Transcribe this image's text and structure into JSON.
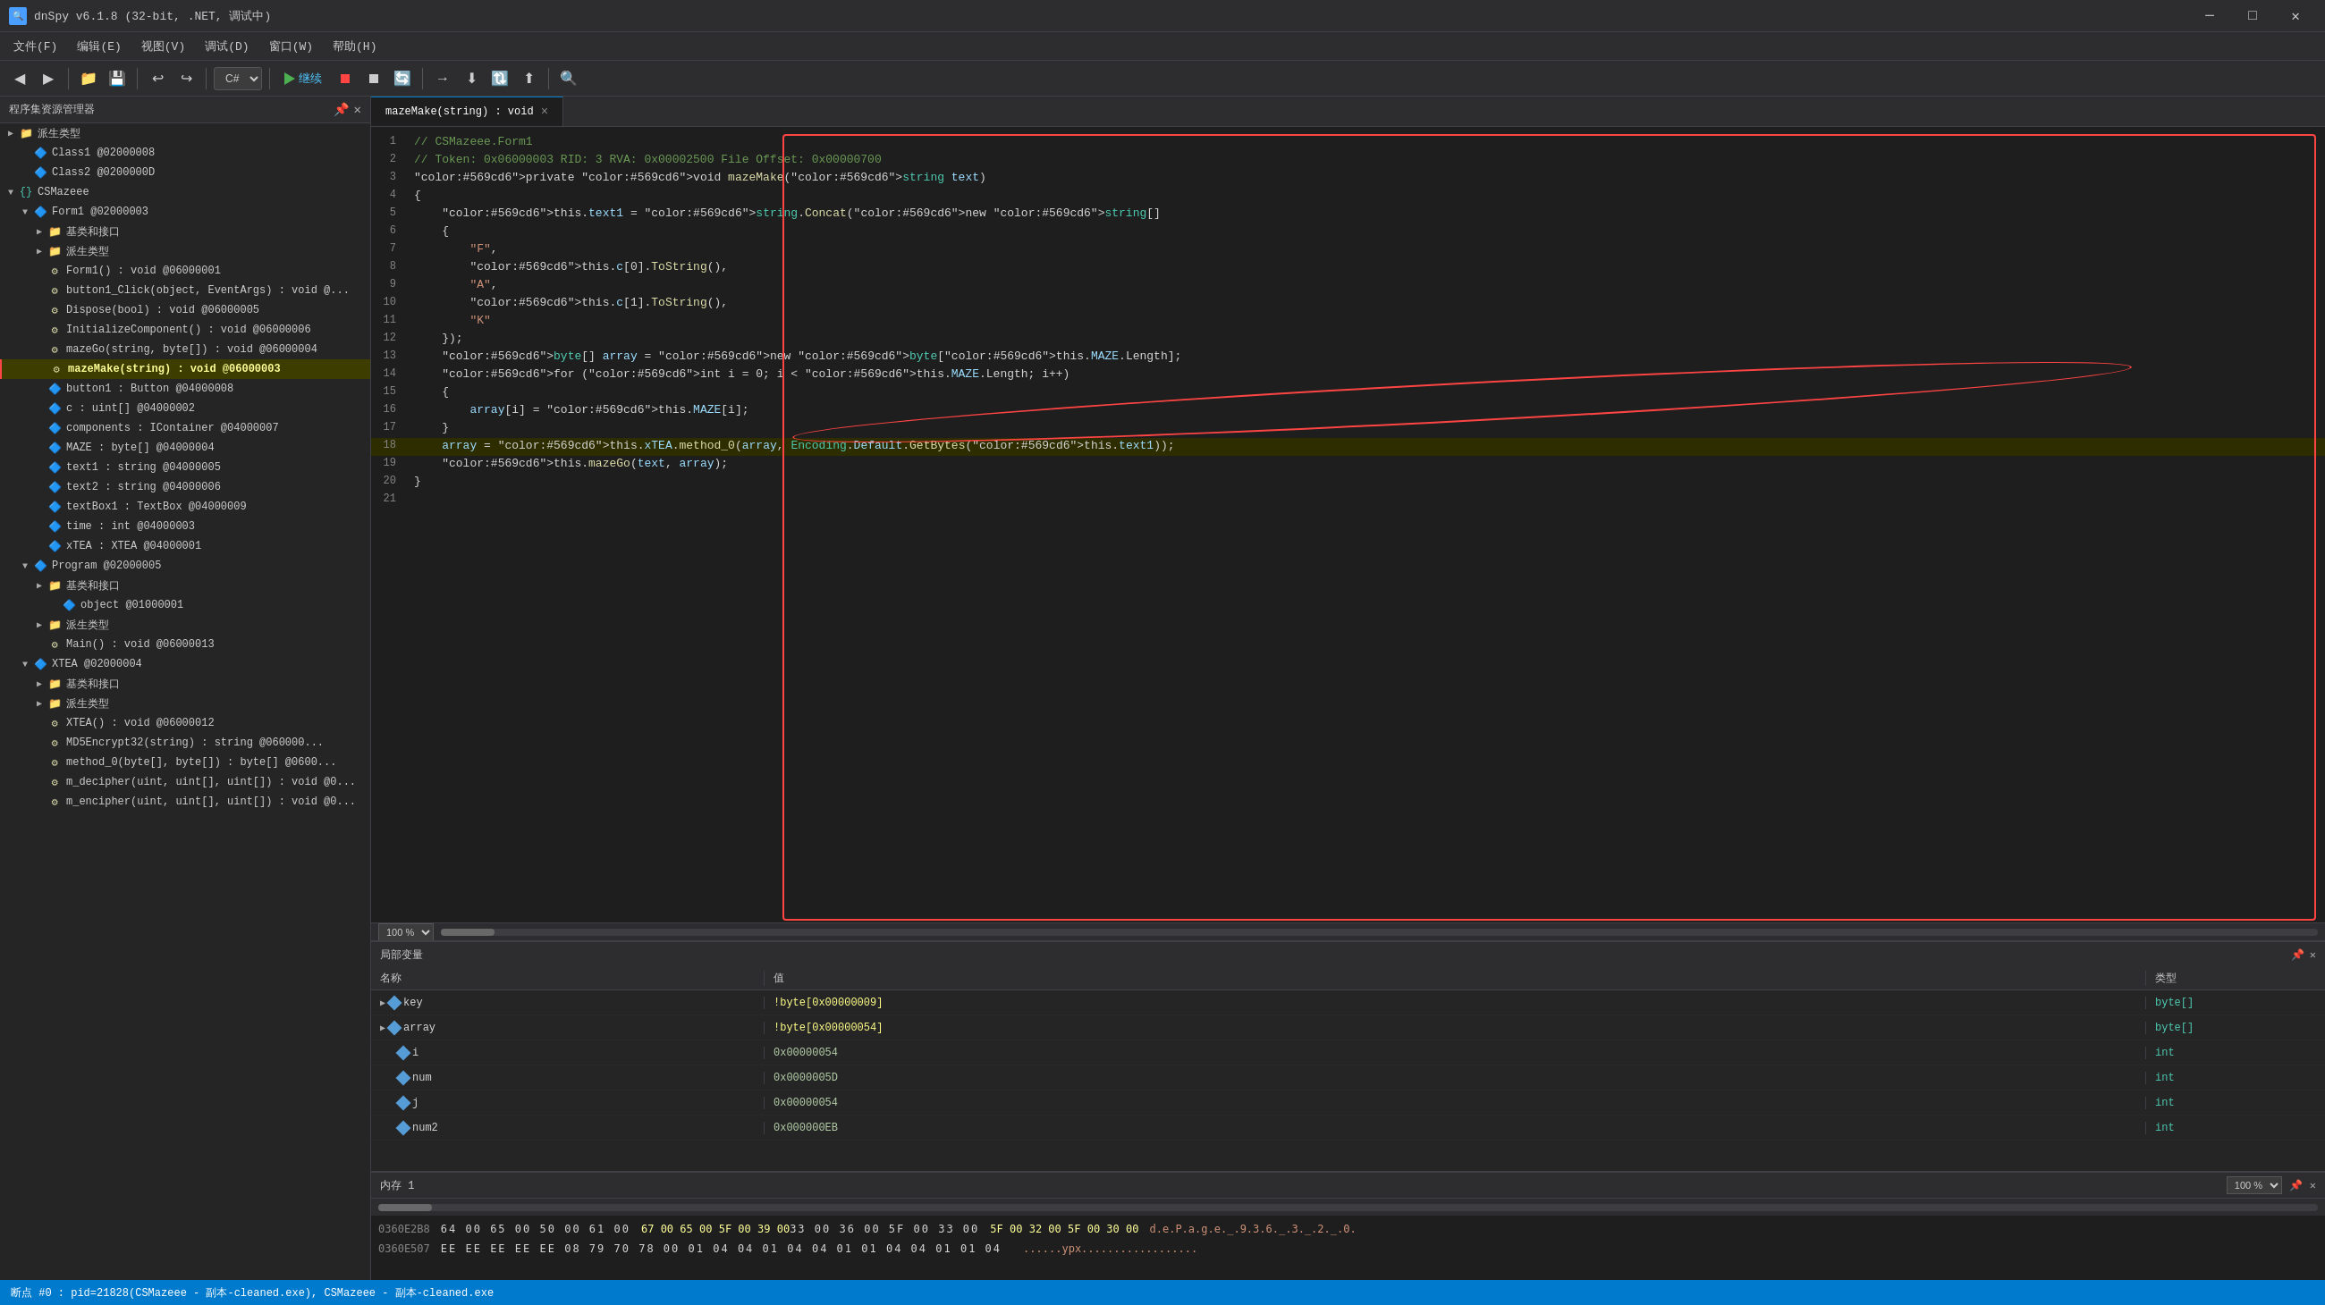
{
  "titlebar": {
    "title": "dnSpy v6.1.8 (32-bit, .NET, 调试中)",
    "icon": "🔍",
    "minimize": "─",
    "maximize": "□",
    "close": "✕"
  },
  "menubar": {
    "items": [
      "文件(F)",
      "编辑(E)",
      "视图(V)",
      "调试(D)",
      "窗口(W)",
      "帮助(H)"
    ]
  },
  "toolbar": {
    "language": "C#",
    "continue_label": "继续",
    "buttons": [
      "◀",
      "▶",
      "📁",
      "💾",
      "↩",
      "↪",
      "▶",
      "⏹",
      "🔄",
      "→",
      "⬇",
      "🔃",
      "⬆",
      "🔍"
    ]
  },
  "sidebar": {
    "title": "程序集资源管理器",
    "tree": [
      {
        "indent": 0,
        "arrow": "▶",
        "icon": "📁",
        "icon_class": "icon-folder",
        "label": "派生类型",
        "level": 1
      },
      {
        "indent": 1,
        "arrow": "",
        "icon": "🔷",
        "icon_class": "icon-class",
        "label": "Class1 @02000008",
        "level": 2
      },
      {
        "indent": 1,
        "arrow": "",
        "icon": "🔷",
        "icon_class": "icon-class",
        "label": "Class2 @0200000D",
        "level": 2
      },
      {
        "indent": 0,
        "arrow": "▼",
        "icon": "{}",
        "icon_class": "icon-class",
        "label": "CSMazeee",
        "level": 1
      },
      {
        "indent": 1,
        "arrow": "▼",
        "icon": "🔷",
        "icon_class": "icon-class",
        "label": "Form1 @02000003",
        "level": 2
      },
      {
        "indent": 2,
        "arrow": "▶",
        "icon": "📁",
        "icon_class": "icon-folder",
        "label": "基类和接口",
        "level": 3
      },
      {
        "indent": 2,
        "arrow": "▶",
        "icon": "📁",
        "icon_class": "icon-folder",
        "label": "派生类型",
        "level": 3
      },
      {
        "indent": 2,
        "arrow": "",
        "icon": "⚙",
        "icon_class": "icon-method",
        "label": "Form1() : void @06000001",
        "level": 3
      },
      {
        "indent": 2,
        "arrow": "",
        "icon": "⚙",
        "icon_class": "icon-method",
        "label": "button1_Click(object, EventArgs) : void @...",
        "level": 3
      },
      {
        "indent": 2,
        "arrow": "",
        "icon": "⚙",
        "icon_class": "icon-method",
        "label": "Dispose(bool) : void @06000005",
        "level": 3
      },
      {
        "indent": 2,
        "arrow": "",
        "icon": "⚙",
        "icon_class": "icon-method",
        "label": "InitializeComponent() : void @06000006",
        "level": 3
      },
      {
        "indent": 2,
        "arrow": "",
        "icon": "⚙",
        "icon_class": "icon-method",
        "label": "mazeGo(string, byte[]) : void @06000004",
        "level": 3
      },
      {
        "indent": 2,
        "arrow": "",
        "icon": "⚙",
        "icon_class": "icon-method",
        "label": "mazeMake(string) : void @06000003",
        "level": 3,
        "active": true
      },
      {
        "indent": 2,
        "arrow": "",
        "icon": "🔷",
        "icon_class": "icon-blue",
        "label": "button1 : Button @04000008",
        "level": 3
      },
      {
        "indent": 2,
        "arrow": "",
        "icon": "🔷",
        "icon_class": "icon-blue",
        "label": "c : uint[] @04000002",
        "level": 3
      },
      {
        "indent": 2,
        "arrow": "",
        "icon": "🔷",
        "icon_class": "icon-blue",
        "label": "components : IContainer @04000007",
        "level": 3
      },
      {
        "indent": 2,
        "arrow": "",
        "icon": "🔷",
        "icon_class": "icon-blue",
        "label": "MAZE : byte[] @04000004",
        "level": 3
      },
      {
        "indent": 2,
        "arrow": "",
        "icon": "🔷",
        "icon_class": "icon-blue",
        "label": "text1 : string @04000005",
        "level": 3
      },
      {
        "indent": 2,
        "arrow": "",
        "icon": "🔷",
        "icon_class": "icon-blue",
        "label": "text2 : string @04000006",
        "level": 3
      },
      {
        "indent": 2,
        "arrow": "",
        "icon": "🔷",
        "icon_class": "icon-blue",
        "label": "textBox1 : TextBox @04000009",
        "level": 3
      },
      {
        "indent": 2,
        "arrow": "",
        "icon": "🔷",
        "icon_class": "icon-blue",
        "label": "time : int @04000003",
        "level": 3
      },
      {
        "indent": 2,
        "arrow": "",
        "icon": "🔷",
        "icon_class": "icon-blue",
        "label": "xTEA : XTEA @04000001",
        "level": 3
      },
      {
        "indent": 1,
        "arrow": "▼",
        "icon": "🔷",
        "icon_class": "icon-class",
        "label": "Program @02000005",
        "level": 2
      },
      {
        "indent": 2,
        "arrow": "▶",
        "icon": "📁",
        "icon_class": "icon-folder",
        "label": "基类和接口",
        "level": 3
      },
      {
        "indent": 3,
        "arrow": "",
        "icon": "🔷",
        "icon_class": "icon-blue",
        "label": "object @01000001",
        "level": 4
      },
      {
        "indent": 2,
        "arrow": "▶",
        "icon": "📁",
        "icon_class": "icon-folder",
        "label": "派生类型",
        "level": 3
      },
      {
        "indent": 2,
        "arrow": "",
        "icon": "⚙",
        "icon_class": "icon-method",
        "label": "Main() : void @06000013",
        "level": 3
      },
      {
        "indent": 1,
        "arrow": "▼",
        "icon": "🔷",
        "icon_class": "icon-class",
        "label": "XTEA @02000004",
        "level": 2
      },
      {
        "indent": 2,
        "arrow": "▶",
        "icon": "📁",
        "icon_class": "icon-folder",
        "label": "基类和接口",
        "level": 3
      },
      {
        "indent": 2,
        "arrow": "▶",
        "icon": "📁",
        "icon_class": "icon-folder",
        "label": "派生类型",
        "level": 3
      },
      {
        "indent": 2,
        "arrow": "",
        "icon": "⚙",
        "icon_class": "icon-method",
        "label": "XTEA() : void @06000012",
        "level": 3
      },
      {
        "indent": 2,
        "arrow": "",
        "icon": "⚙",
        "icon_class": "icon-method",
        "label": "MD5Encrypt32(string) : string @060000...",
        "level": 3
      },
      {
        "indent": 2,
        "arrow": "",
        "icon": "⚙",
        "icon_class": "icon-method",
        "label": "method_0(byte[], byte[]) : byte[] @0600...",
        "level": 3
      },
      {
        "indent": 2,
        "arrow": "",
        "icon": "⚙",
        "icon_class": "icon-method",
        "label": "m_decipher(uint, uint[], uint[]) : void @0...",
        "level": 3
      },
      {
        "indent": 2,
        "arrow": "",
        "icon": "⚙",
        "icon_class": "icon-method",
        "label": "m_encipher(uint, uint[], uint[]) : void @0...",
        "level": 3
      }
    ]
  },
  "tab": {
    "label": "mazeMake(string) : void",
    "close": "×"
  },
  "code": {
    "lines": [
      {
        "num": 1,
        "text": "// CSMazeee.Form1",
        "type": "comment"
      },
      {
        "num": 2,
        "text": "// Token: 0x06000003 RID: 3 RVA: 0x00002500 File Offset: 0x00000700",
        "type": "comment"
      },
      {
        "num": 3,
        "text": "private void mazeMake(string text)",
        "type": "code"
      },
      {
        "num": 4,
        "text": "{",
        "type": "code"
      },
      {
        "num": 5,
        "text": "    this.text1 = string.Concat(new string[]",
        "type": "code"
      },
      {
        "num": 6,
        "text": "    {",
        "type": "code"
      },
      {
        "num": 7,
        "text": "        \"F\",",
        "type": "code"
      },
      {
        "num": 8,
        "text": "        this.c[0].ToString(),",
        "type": "code"
      },
      {
        "num": 9,
        "text": "        \"A\",",
        "type": "code"
      },
      {
        "num": 10,
        "text": "        this.c[1].ToString(),",
        "type": "code"
      },
      {
        "num": 11,
        "text": "        \"K\"",
        "type": "code"
      },
      {
        "num": 12,
        "text": "    });",
        "type": "code"
      },
      {
        "num": 13,
        "text": "    byte[] array = new byte[this.MAZE.Length];",
        "type": "code"
      },
      {
        "num": 14,
        "text": "    for (int i = 0; i < this.MAZE.Length; i++)",
        "type": "code"
      },
      {
        "num": 15,
        "text": "    {",
        "type": "code"
      },
      {
        "num": 16,
        "text": "        array[i] = this.MAZE[i];",
        "type": "code"
      },
      {
        "num": 17,
        "text": "    }",
        "type": "code"
      },
      {
        "num": 18,
        "text": "    array = this.xTEA.method_0(array, Encoding.Default.GetBytes(this.text1));",
        "type": "code",
        "highlighted": true
      },
      {
        "num": 19,
        "text": "    this.mazeGo(text, array);",
        "type": "code"
      },
      {
        "num": 20,
        "text": "}",
        "type": "code"
      },
      {
        "num": 21,
        "text": "",
        "type": "code"
      }
    ]
  },
  "zoom": "100 %",
  "locals": {
    "title": "局部变量",
    "columns": [
      "名称",
      "值",
      "类型"
    ],
    "rows": [
      {
        "name": "key",
        "expandable": true,
        "value": "!byte[0x00000009]",
        "value_highlighted": true,
        "type": "byte[]"
      },
      {
        "name": "array",
        "expandable": true,
        "value": "!byte[0x00000054]",
        "value_highlighted": true,
        "type": "byte[]"
      },
      {
        "name": "i",
        "expandable": false,
        "value": "0x00000054",
        "value_highlighted": false,
        "type": "int"
      },
      {
        "name": "num",
        "expandable": false,
        "value": "0x0000005D",
        "value_highlighted": false,
        "type": "int"
      },
      {
        "name": "j",
        "expandable": false,
        "value": "0x00000054",
        "value_highlighted": false,
        "type": "int"
      },
      {
        "name": "num2",
        "expandable": false,
        "value": "0x000000EB",
        "value_highlighted": false,
        "type": "int"
      }
    ]
  },
  "memory": {
    "title": "内存 1",
    "zoom": "100 %",
    "rows": [
      {
        "addr": "0360E2B8",
        "bytes": "64 00 65 00 50 00 61 00 67 00 65 00 5F 00 39 00 33 00 36 00 5F 00 33 00 5F 00 32 00 30 00",
        "ascii": "d.e.P.a.g.e._.9.3.6._.3._.2._.0."
      },
      {
        "addr": "0360E507",
        "bytes": "EE EE EE EE EE 08 79 70 78 00 01 04 04 01 04 04 01 01 04 04 01 01 04",
        "ascii": "......ypx.................."
      }
    ]
  },
  "statusbar": {
    "text": "断点 #0 : pid=21828(CSMazeee - 副本-cleaned.exe), CSMazeee - 副本-cleaned.exe"
  }
}
